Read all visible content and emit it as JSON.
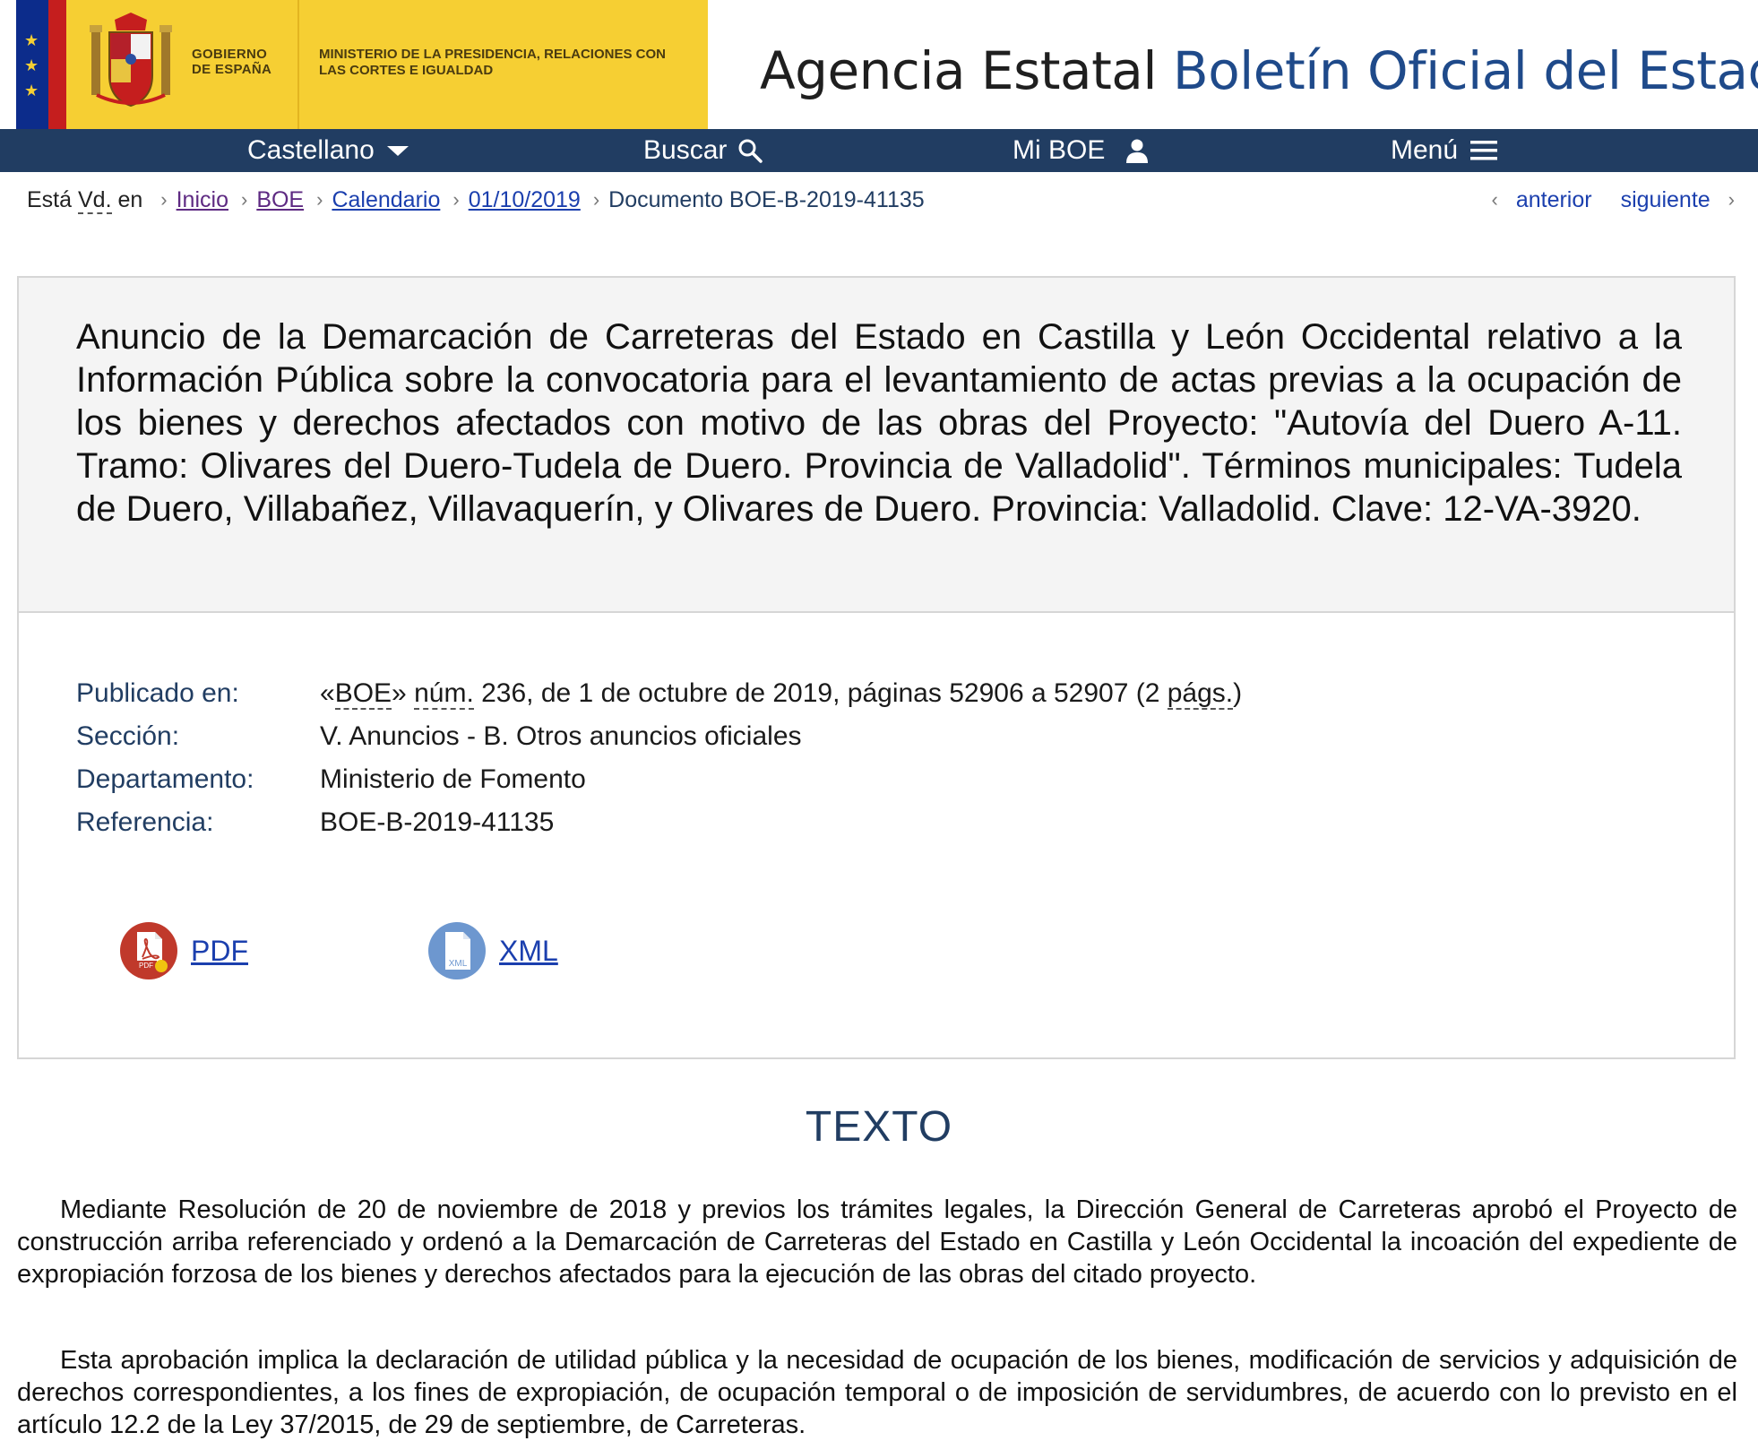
{
  "header": {
    "gov_line1": "Gobierno",
    "gov_line2": "de España",
    "ministry": "Ministerio de la Presidencia, Relaciones con las Cortes e Igualdad",
    "agency_prefix": "Agencia Estatal",
    "agency_name": "Boletín Oficial del Estado",
    "colors": {
      "gov_yellow": "#f6cf33",
      "nav_blue": "#213d62",
      "eu_blue": "#0c2c8b",
      "flag_red": "#c51e1e"
    }
  },
  "nav": {
    "language": "Castellano",
    "search": "Buscar",
    "my_boe": "Mi BOE",
    "menu": "Menú",
    "icons": [
      "chevron-down-icon",
      "search-icon",
      "user-icon",
      "hamburger-menu-icon"
    ]
  },
  "breadcrumb": {
    "lead": "Está",
    "lead_abbr": "Vd.",
    "lead_suffix": "en",
    "items": [
      "Inicio",
      "BOE",
      "Calendario",
      "01/10/2019"
    ],
    "current": "Documento BOE-B-2019-41135"
  },
  "pager": {
    "prev": "anterior",
    "next": "siguiente"
  },
  "document": {
    "title": "Anuncio de la Demarcación de Carreteras del Estado en Castilla y León Occidental relativo a la Información Pública sobre la convocatoria para el levantamiento de actas previas a la ocupación de los bienes y derechos afectados con motivo de las obras del Proyecto: \"Autovía del Duero A-11. Tramo: Olivares del Duero-Tudela de Duero. Provincia de Valladolid\". Términos municipales: Tudela de Duero, Villabañez, Villavaquerín, y Olivares de Duero. Provincia: Valladolid. Clave: 12-VA-3920.",
    "meta": {
      "published_label": "Publicado en:",
      "published_pre": "«",
      "published_abbr": "BOE",
      "published_mid": "» ",
      "published_num_abbr": "núm.",
      "published_rest": " 236, de 1 de octubre de 2019, páginas 52906 a 52907 (2 ",
      "published_pags_abbr": "págs.",
      "published_end": ")",
      "section_label": "Sección:",
      "section_value": "V. Anuncios - B. Otros anuncios oficiales",
      "department_label": "Departamento:",
      "department_value": "Ministerio de Fomento",
      "reference_label": "Referencia:",
      "reference_value": "BOE-B-2019-41135"
    },
    "downloads": {
      "pdf_label": "PDF",
      "xml_label": "XML",
      "pdf_icon_text": "PDF",
      "xml_icon_text": "XML"
    }
  },
  "text_section": {
    "title": "TEXTO",
    "paragraphs": [
      "Mediante Resolución de 20 de noviembre de 2018 y previos los trámites legales, la Dirección General de Carreteras aprobó el Proyecto de construcción arriba referenciado y ordenó a la Demarcación de Carreteras del Estado en Castilla y León Occidental la incoación del expediente de expropiación forzosa de los bienes y derechos afectados para la ejecución de las obras del citado proyecto.",
      "Esta aprobación implica la declaración de utilidad pública y la necesidad de ocupación de los bienes, modificación de servicios y adquisición de derechos correspondientes, a los fines de expropiación, de ocupación temporal o de imposición de servidumbres, de acuerdo con lo previsto en el artículo 12.2 de la Ley 37/2015, de 29 de septiembre, de Carreteras."
    ]
  }
}
